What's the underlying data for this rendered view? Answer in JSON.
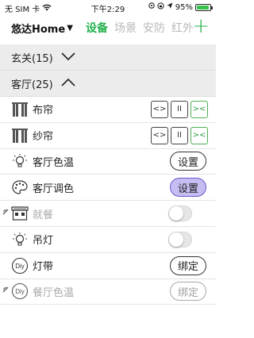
{
  "status_bar": {
    "carrier": "无 SIM 卡",
    "time": "下午2:29",
    "battery_percent": "95%",
    "battery_level": 0.95,
    "battery_color": "#36c24a"
  },
  "header": {
    "home_name": "悠达Home",
    "dropdown_glyph": "▼",
    "tabs": [
      "设备",
      "场景",
      "安防",
      "红外"
    ],
    "active_tab": 0,
    "add_glyph": "+"
  },
  "groups": [
    {
      "label": "玄关(15)",
      "expanded": false
    },
    {
      "label": "客厅(25)",
      "expanded": true
    }
  ],
  "devices": [
    {
      "label": "布帘",
      "icon": "curtain-icon",
      "controls": [
        "<>",
        "II",
        "><"
      ]
    },
    {
      "label": "纱帘",
      "icon": "curtain-icon",
      "controls": [
        "<>",
        "II",
        "><"
      ]
    },
    {
      "label": "客厅色温",
      "icon": "bulb-icon",
      "button": "设置"
    },
    {
      "label": "客厅调色",
      "icon": "palette-icon",
      "button": "设置"
    },
    {
      "label": "就餐",
      "icon": "scene-icon",
      "toggle": false,
      "disabled": true
    },
    {
      "label": "吊灯",
      "icon": "bulb-icon",
      "toggle": false
    },
    {
      "label": "灯带",
      "icon": "diy-icon",
      "icon_text": "Diy",
      "button": "绑定"
    },
    {
      "label": "餐厅色温",
      "icon": "diy-icon",
      "icon_text": "Diy",
      "button": "绑定",
      "disabled": true
    }
  ],
  "colors": {
    "accent": "#22b14c",
    "purple_button": "#c7bdf3",
    "group_bg": "#ececec"
  }
}
